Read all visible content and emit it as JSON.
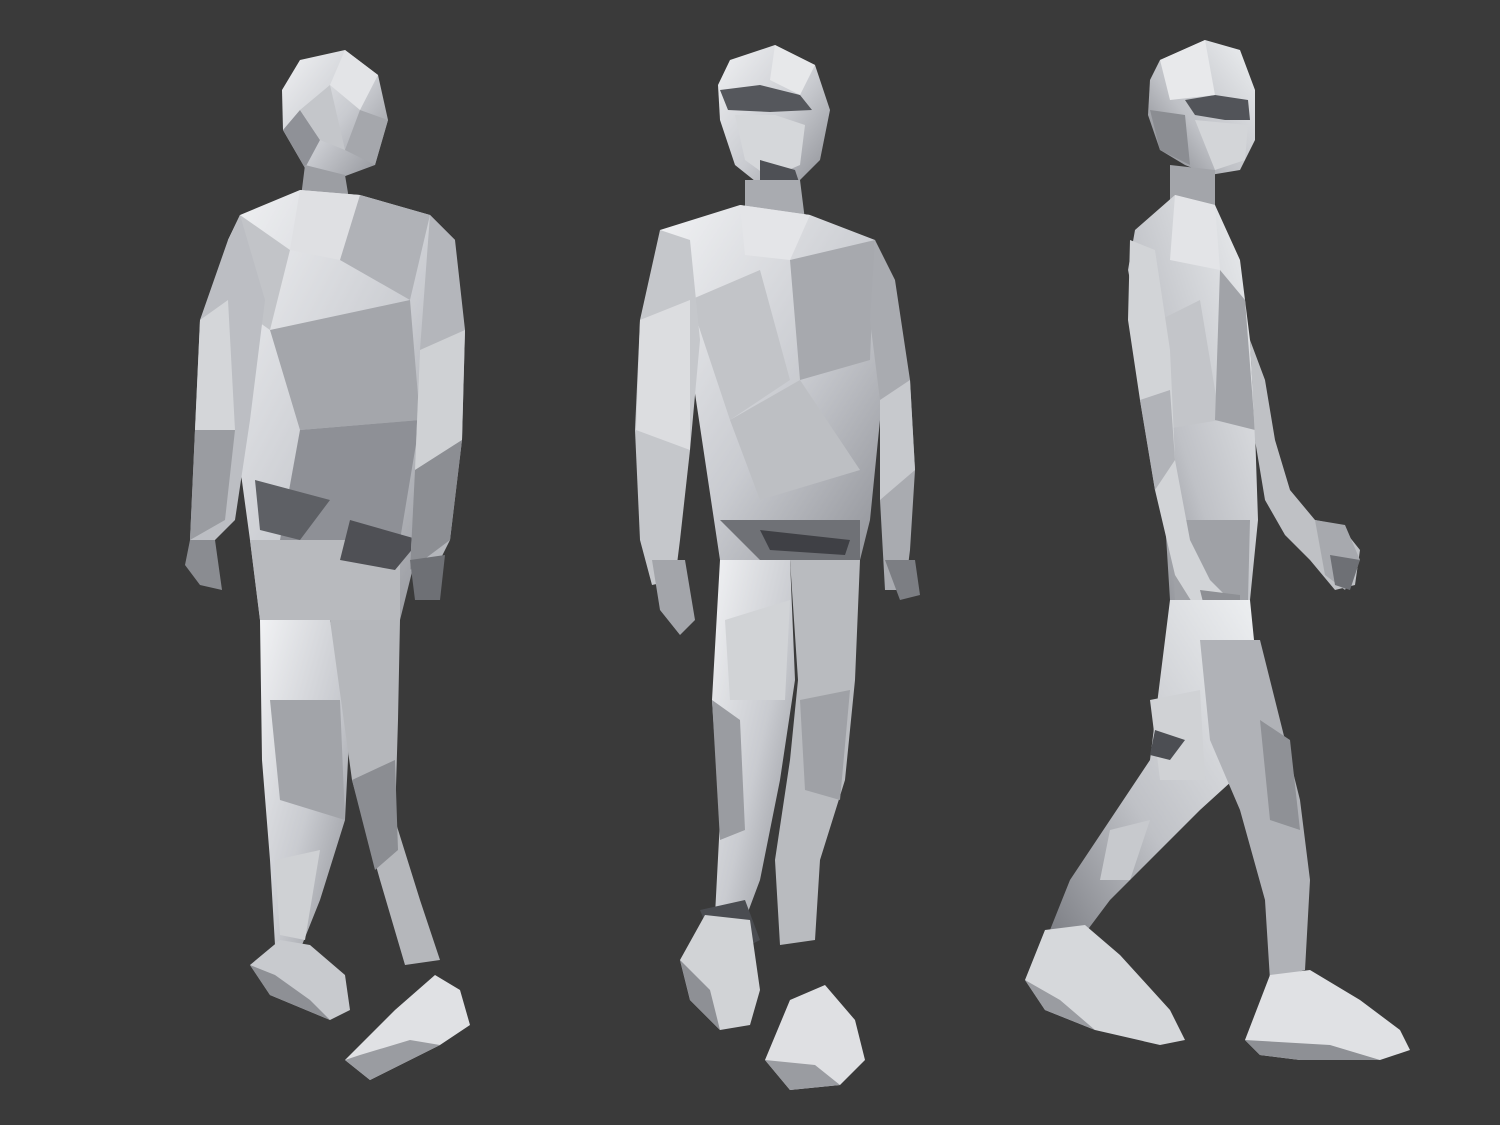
{
  "scene": {
    "background_color": "#3a3a3a",
    "mesh_light": "#e6e7ea",
    "mesh_mid": "#b9bbc0",
    "mesh_dark": "#7b7d83",
    "mesh_shadow": "#4a4b50"
  },
  "figures": [
    {
      "name": "walking-figure-back-view",
      "view": "back"
    },
    {
      "name": "walking-figure-front-view",
      "view": "front"
    },
    {
      "name": "walking-figure-side-view",
      "view": "side"
    }
  ]
}
